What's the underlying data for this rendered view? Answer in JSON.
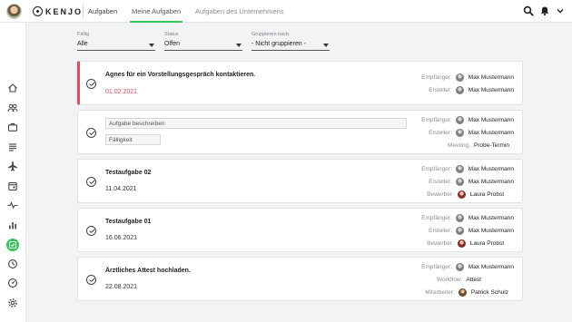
{
  "app": {
    "logo_text": "KENJO"
  },
  "nav": {
    "tabs": [
      {
        "label": "Aufgaben"
      },
      {
        "label": "Meine Aufgaben"
      },
      {
        "label": "Aufgaben des Unternehmens"
      }
    ],
    "active_tab": "Meine Aufgaben"
  },
  "colors": {
    "accent": "#34c759",
    "overdue": "#e74c57"
  },
  "sidebar": {
    "items": [
      "home-icon",
      "people-icon",
      "briefcase-icon",
      "document-icon",
      "plane-icon",
      "calendar-icon",
      "pulse-icon",
      "bar-chart-icon",
      "tasks-icon",
      "clock-icon",
      "gauge-icon",
      "settings-icon"
    ],
    "active": "tasks-icon"
  },
  "filters": {
    "due": {
      "label": "Fällig",
      "value": "Alle"
    },
    "status": {
      "label": "Status",
      "value": "Offen"
    },
    "group": {
      "label": "Gruppieren nach",
      "value": "- Nicht gruppieren -"
    }
  },
  "tasks": [
    {
      "title": "Agnes für ein Vorstellungsgespräch kontaktieren.",
      "date": "01.02.2021",
      "overdue": true,
      "meta": [
        {
          "label": "Empfänger:",
          "value": "Max Mustermann"
        },
        {
          "label": "Ersteller:",
          "value": "Max Mustermann"
        }
      ]
    },
    {
      "title_placeholder": "Aufgabe beschreiben",
      "date_placeholder": "Fälligkeit",
      "meta": [
        {
          "label": "Empfänger:",
          "value": "Max Mustermann"
        },
        {
          "label": "Ersteller:",
          "value": "Max Mustermann"
        },
        {
          "label": "Meeting:",
          "value": "Probe-Termin"
        }
      ]
    },
    {
      "title": "Testaufgabe 02",
      "date": "11.04.2021",
      "meta": [
        {
          "label": "Empfänger:",
          "value": "Max Mustermann"
        },
        {
          "label": "Ersteller:",
          "value": "Max Mustermann"
        },
        {
          "label": "Bewerber:",
          "value": "Laura Probst"
        }
      ]
    },
    {
      "title": "Testaufgabe 01",
      "date": "16.06.2021",
      "meta": [
        {
          "label": "Empfänger:",
          "value": "Max Mustermann"
        },
        {
          "label": "Ersteller:",
          "value": "Max Mustermann"
        },
        {
          "label": "Bewerber:",
          "value": "Laura Probst"
        }
      ]
    },
    {
      "title": "Ärztliches Attest hochladen.",
      "date": "22.08.2021",
      "meta": [
        {
          "label": "Empfänger:",
          "value": "Max Mustermann"
        },
        {
          "label": "Workflow:",
          "value": "Attest"
        },
        {
          "label": "Mitarbeiter:",
          "value": "Patrick Schulz"
        }
      ]
    }
  ]
}
